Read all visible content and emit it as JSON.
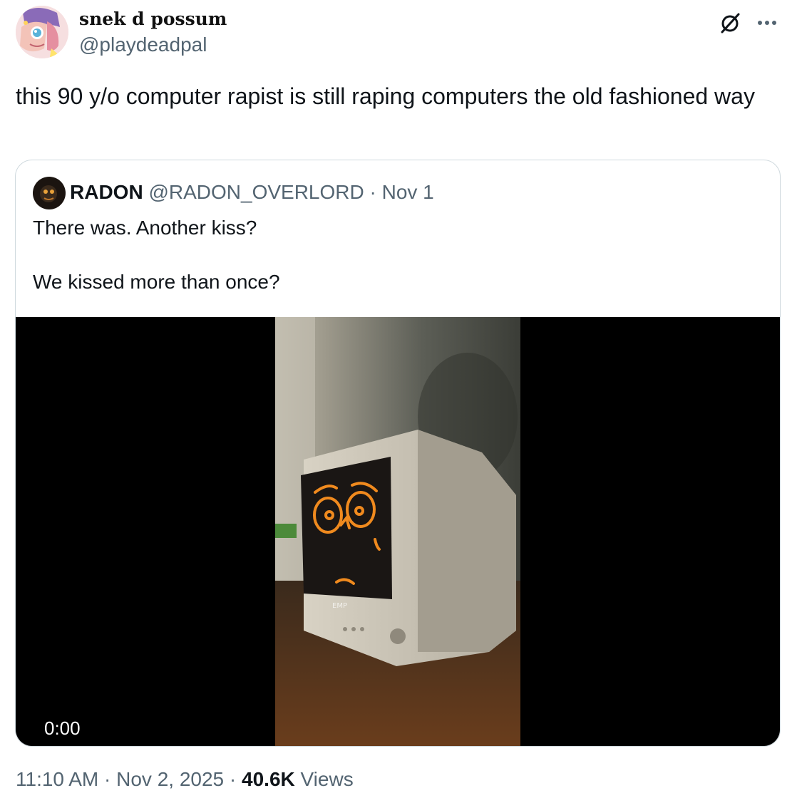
{
  "author": {
    "display_name": "snek d possum",
    "handle": "@playdeadpal"
  },
  "header_icons": {
    "grok": "slashed-circle-icon",
    "more": "more-icon"
  },
  "tweet": {
    "text": "this 90 y/o computer rapist is still raping computers the old fashioned way"
  },
  "quoted": {
    "display_name": "RADON",
    "handle": "@RADON_OVERLORD",
    "separator": "·",
    "date": "Nov 1",
    "paragraphs": [
      "There was. Another kiss?",
      "We kissed more than once?"
    ],
    "video": {
      "timecode": "0:00",
      "screen_brand": "EMP"
    }
  },
  "meta": {
    "time": "11:10 AM",
    "sep1": "·",
    "date": "Nov 2, 2025",
    "sep2": "·",
    "views_count": "40.6K",
    "views_label": "Views"
  }
}
